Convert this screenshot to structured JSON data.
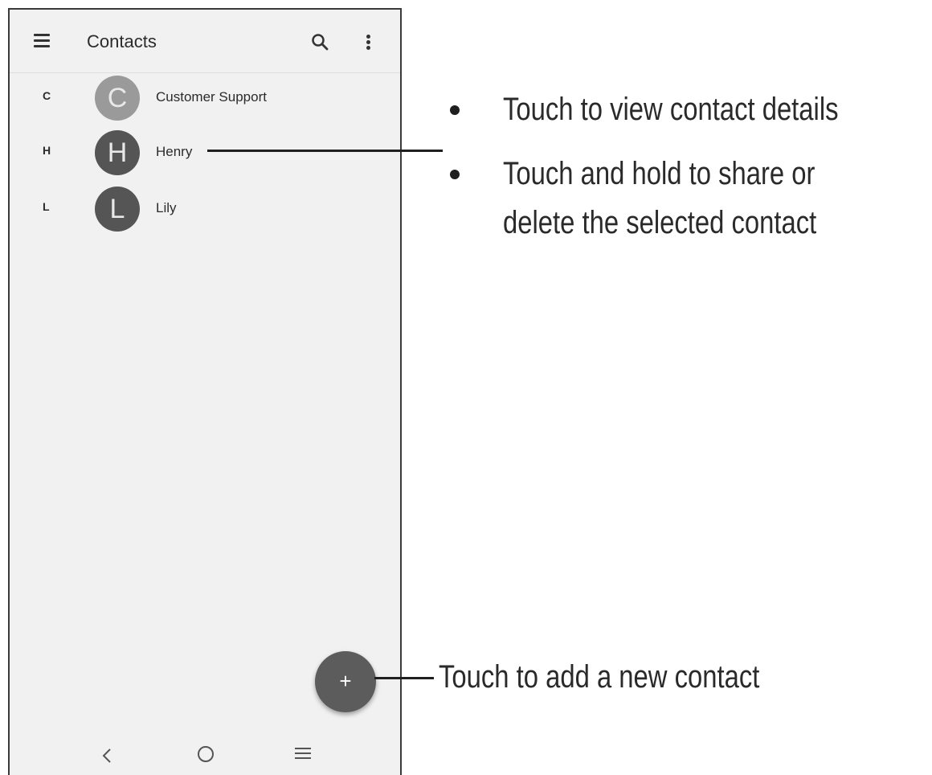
{
  "app": {
    "title": "Contacts",
    "icons": {
      "menu": "menu-icon",
      "search": "search-icon",
      "more": "more-vert-icon"
    }
  },
  "contacts": [
    {
      "index_letter": "C",
      "avatar_letter": "C",
      "name": "Customer Support",
      "avatar_color": "#9a9a9a"
    },
    {
      "index_letter": "H",
      "avatar_letter": "H",
      "name": "Henry",
      "avatar_color": "#555555"
    },
    {
      "index_letter": "L",
      "avatar_letter": "L",
      "name": "Lily",
      "avatar_color": "#555555"
    }
  ],
  "fab": {
    "label": "+",
    "icon": "add-icon"
  },
  "navbar": {
    "icons": [
      "back-icon",
      "home-icon",
      "recents-icon"
    ]
  },
  "callouts": {
    "contact_bullet_1": "Touch to view contact details",
    "contact_bullet_2_line1": "Touch  and  hold  to  share  or",
    "contact_bullet_2_line2": "delete the selected contact",
    "fab_note": "Touch to add a new contact"
  }
}
